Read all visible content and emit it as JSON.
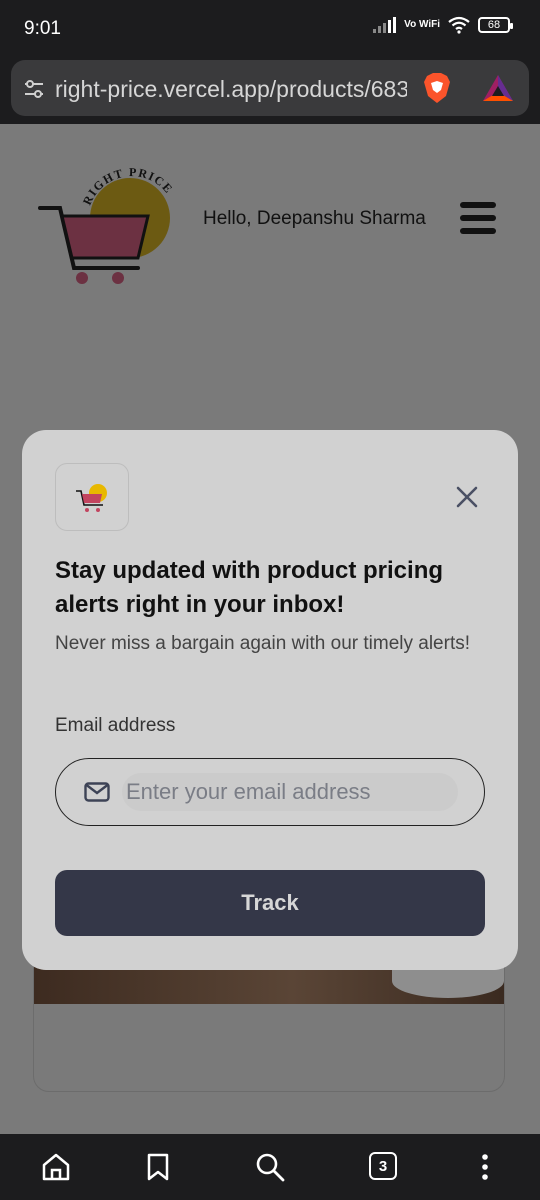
{
  "status_bar": {
    "time": "9:01",
    "network": "Vo WiFi",
    "battery": "68"
  },
  "browser": {
    "url": "right-price.vercel.app/products/683",
    "tab_count": "3"
  },
  "header": {
    "logo_text": "RIGHT PRICE",
    "greeting": "Hello, Deepanshu Sharma"
  },
  "modal": {
    "title": "Stay updated with product pricing alerts right in your inbox!",
    "subtitle": "Never miss a bargain again with our timely alerts!",
    "email_label": "Email address",
    "email_placeholder": "Enter your email address",
    "track_label": "Track"
  },
  "colors": {
    "accent": "#343748",
    "overlay": "#7a7a7a",
    "modal_bg": "#d1d1d1"
  }
}
